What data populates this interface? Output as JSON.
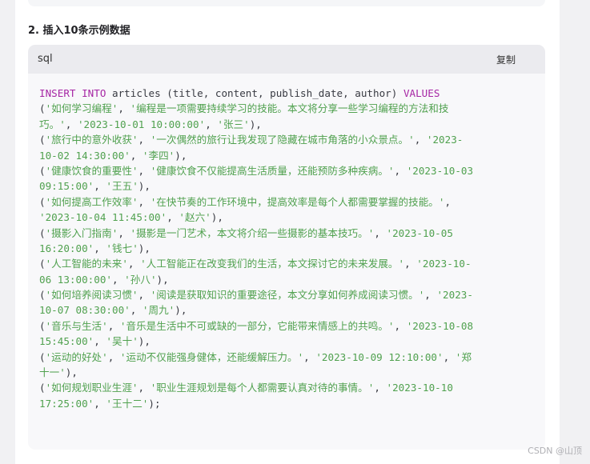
{
  "section": {
    "heading": "2. 插入10条示例数据"
  },
  "code_block": {
    "language": "sql",
    "copy_label": "复制",
    "lines": [
      [
        {
          "t": "kw",
          "v": "INSERT INTO"
        },
        {
          "t": "plain",
          "v": " articles (title, content, publish_date, author) "
        },
        {
          "t": "kw",
          "v": "VALUES"
        }
      ],
      [
        {
          "t": "plain",
          "v": "("
        },
        {
          "t": "str",
          "v": "'如何学习编程'"
        },
        {
          "t": "plain",
          "v": ", "
        },
        {
          "t": "str",
          "v": "'编程是一项需要持续学习的技能。本文将分享一些学习编程的方法和技"
        }
      ],
      [
        {
          "t": "str",
          "v": "巧。'"
        },
        {
          "t": "plain",
          "v": ", "
        },
        {
          "t": "str",
          "v": "'2023-10-01 10:00:00'"
        },
        {
          "t": "plain",
          "v": ", "
        },
        {
          "t": "str",
          "v": "'张三'"
        },
        {
          "t": "plain",
          "v": "),"
        }
      ],
      [
        {
          "t": "plain",
          "v": "("
        },
        {
          "t": "str",
          "v": "'旅行中的意外收获'"
        },
        {
          "t": "plain",
          "v": ", "
        },
        {
          "t": "str",
          "v": "'一次偶然的旅行让我发现了隐藏在城市角落的小众景点。'"
        },
        {
          "t": "plain",
          "v": ", "
        },
        {
          "t": "str",
          "v": "'2023-"
        }
      ],
      [
        {
          "t": "str",
          "v": "10-02 14:30:00'"
        },
        {
          "t": "plain",
          "v": ", "
        },
        {
          "t": "str",
          "v": "'李四'"
        },
        {
          "t": "plain",
          "v": "),"
        }
      ],
      [
        {
          "t": "plain",
          "v": "("
        },
        {
          "t": "str",
          "v": "'健康饮食的重要性'"
        },
        {
          "t": "plain",
          "v": ", "
        },
        {
          "t": "str",
          "v": "'健康饮食不仅能提高生活质量，还能预防多种疾病。'"
        },
        {
          "t": "plain",
          "v": ", "
        },
        {
          "t": "str",
          "v": "'2023-10-03"
        }
      ],
      [
        {
          "t": "str",
          "v": "09:15:00'"
        },
        {
          "t": "plain",
          "v": ", "
        },
        {
          "t": "str",
          "v": "'王五'"
        },
        {
          "t": "plain",
          "v": "),"
        }
      ],
      [
        {
          "t": "plain",
          "v": "("
        },
        {
          "t": "str",
          "v": "'如何提高工作效率'"
        },
        {
          "t": "plain",
          "v": ", "
        },
        {
          "t": "str",
          "v": "'在快节奏的工作环境中，提高效率是每个人都需要掌握的技能。'"
        },
        {
          "t": "plain",
          "v": ","
        }
      ],
      [
        {
          "t": "str",
          "v": "'2023-10-04 11:45:00'"
        },
        {
          "t": "plain",
          "v": ", "
        },
        {
          "t": "str",
          "v": "'赵六'"
        },
        {
          "t": "plain",
          "v": "),"
        }
      ],
      [
        {
          "t": "plain",
          "v": "("
        },
        {
          "t": "str",
          "v": "'摄影入门指南'"
        },
        {
          "t": "plain",
          "v": ", "
        },
        {
          "t": "str",
          "v": "'摄影是一门艺术，本文将介绍一些摄影的基本技巧。'"
        },
        {
          "t": "plain",
          "v": ", "
        },
        {
          "t": "str",
          "v": "'2023-10-05"
        }
      ],
      [
        {
          "t": "str",
          "v": "16:20:00'"
        },
        {
          "t": "plain",
          "v": ", "
        },
        {
          "t": "str",
          "v": "'钱七'"
        },
        {
          "t": "plain",
          "v": "),"
        }
      ],
      [
        {
          "t": "plain",
          "v": "("
        },
        {
          "t": "str",
          "v": "'人工智能的未来'"
        },
        {
          "t": "plain",
          "v": ", "
        },
        {
          "t": "str",
          "v": "'人工智能正在改变我们的生活，本文探讨它的未来发展。'"
        },
        {
          "t": "plain",
          "v": ", "
        },
        {
          "t": "str",
          "v": "'2023-10-"
        }
      ],
      [
        {
          "t": "str",
          "v": "06 13:00:00'"
        },
        {
          "t": "plain",
          "v": ", "
        },
        {
          "t": "str",
          "v": "'孙八'"
        },
        {
          "t": "plain",
          "v": "),"
        }
      ],
      [
        {
          "t": "plain",
          "v": "("
        },
        {
          "t": "str",
          "v": "'如何培养阅读习惯'"
        },
        {
          "t": "plain",
          "v": ", "
        },
        {
          "t": "str",
          "v": "'阅读是获取知识的重要途径，本文分享如何养成阅读习惯。'"
        },
        {
          "t": "plain",
          "v": ", "
        },
        {
          "t": "str",
          "v": "'2023-"
        }
      ],
      [
        {
          "t": "str",
          "v": "10-07 08:30:00'"
        },
        {
          "t": "plain",
          "v": ", "
        },
        {
          "t": "str",
          "v": "'周九'"
        },
        {
          "t": "plain",
          "v": "),"
        }
      ],
      [
        {
          "t": "plain",
          "v": "("
        },
        {
          "t": "str",
          "v": "'音乐与生活'"
        },
        {
          "t": "plain",
          "v": ", "
        },
        {
          "t": "str",
          "v": "'音乐是生活中不可或缺的一部分，它能带来情感上的共鸣。'"
        },
        {
          "t": "plain",
          "v": ", "
        },
        {
          "t": "str",
          "v": "'2023-10-08"
        }
      ],
      [
        {
          "t": "str",
          "v": "15:45:00'"
        },
        {
          "t": "plain",
          "v": ", "
        },
        {
          "t": "str",
          "v": "'吴十'"
        },
        {
          "t": "plain",
          "v": "),"
        }
      ],
      [
        {
          "t": "plain",
          "v": "("
        },
        {
          "t": "str",
          "v": "'运动的好处'"
        },
        {
          "t": "plain",
          "v": ", "
        },
        {
          "t": "str",
          "v": "'运动不仅能强身健体，还能缓解压力。'"
        },
        {
          "t": "plain",
          "v": ", "
        },
        {
          "t": "str",
          "v": "'2023-10-09 12:10:00'"
        },
        {
          "t": "plain",
          "v": ", "
        },
        {
          "t": "str",
          "v": "'郑"
        }
      ],
      [
        {
          "t": "str",
          "v": "十一'"
        },
        {
          "t": "plain",
          "v": "),"
        }
      ],
      [
        {
          "t": "plain",
          "v": "("
        },
        {
          "t": "str",
          "v": "'如何规划职业生涯'"
        },
        {
          "t": "plain",
          "v": ", "
        },
        {
          "t": "str",
          "v": "'职业生涯规划是每个人都需要认真对待的事情。'"
        },
        {
          "t": "plain",
          "v": ", "
        },
        {
          "t": "str",
          "v": "'2023-10-10"
        }
      ],
      [
        {
          "t": "str",
          "v": "17:25:00'"
        },
        {
          "t": "plain",
          "v": ", "
        },
        {
          "t": "str",
          "v": "'王十二'"
        },
        {
          "t": "plain",
          "v": ");"
        }
      ]
    ]
  },
  "watermark": "CSDN @山顶"
}
